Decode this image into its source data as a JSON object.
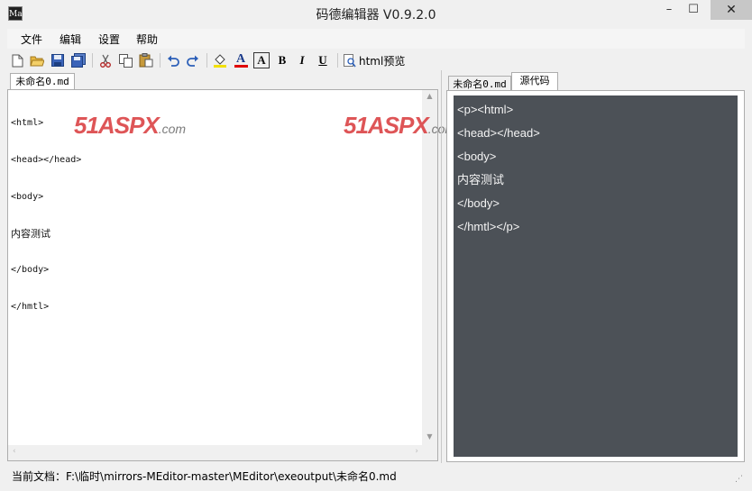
{
  "window": {
    "title": "码德编辑器 V0.9.2.0",
    "icon_text": "Ma",
    "minimize": "–",
    "maximize": "☐",
    "close": "✕"
  },
  "menu": [
    "文件",
    "编辑",
    "设置",
    "帮助"
  ],
  "toolbar": {
    "icons": [
      "new-file-icon",
      "open-folder-icon",
      "save-icon",
      "save-all-icon",
      "cut-icon",
      "copy-icon",
      "paste-icon",
      "undo-icon",
      "redo-icon",
      "fill-color-icon",
      "font-color-icon",
      "font-icon",
      "bold-icon",
      "italic-icon",
      "underline-icon",
      "preview-icon"
    ],
    "bold": "B",
    "italic": "I",
    "underline": "U",
    "font_color": "A",
    "font": "A",
    "preview_label": "html预览"
  },
  "editor": {
    "tab_label": "未命名0.md",
    "lines": [
      "<html>",
      "<head></head>",
      "<body>",
      "内容测试",
      "</body>",
      "</hmtl>"
    ]
  },
  "watermark": {
    "brand": "51ASPX",
    "domain": ".com"
  },
  "preview": {
    "tabs": [
      "未命名0.md",
      "源代码"
    ],
    "lines": [
      "<p><html>",
      "<head></head>",
      "<body>",
      "内容测试",
      "</body>",
      "</hmtl></p>"
    ]
  },
  "status": {
    "text": "当前文档：F:\\临时\\mirrors-MEditor-master\\MEditor\\exeoutput\\未命名0.md"
  },
  "colors": {
    "preview_bg": "#4c5157",
    "watermark": "#d9383a",
    "close_btn": "#c7c7c7"
  }
}
